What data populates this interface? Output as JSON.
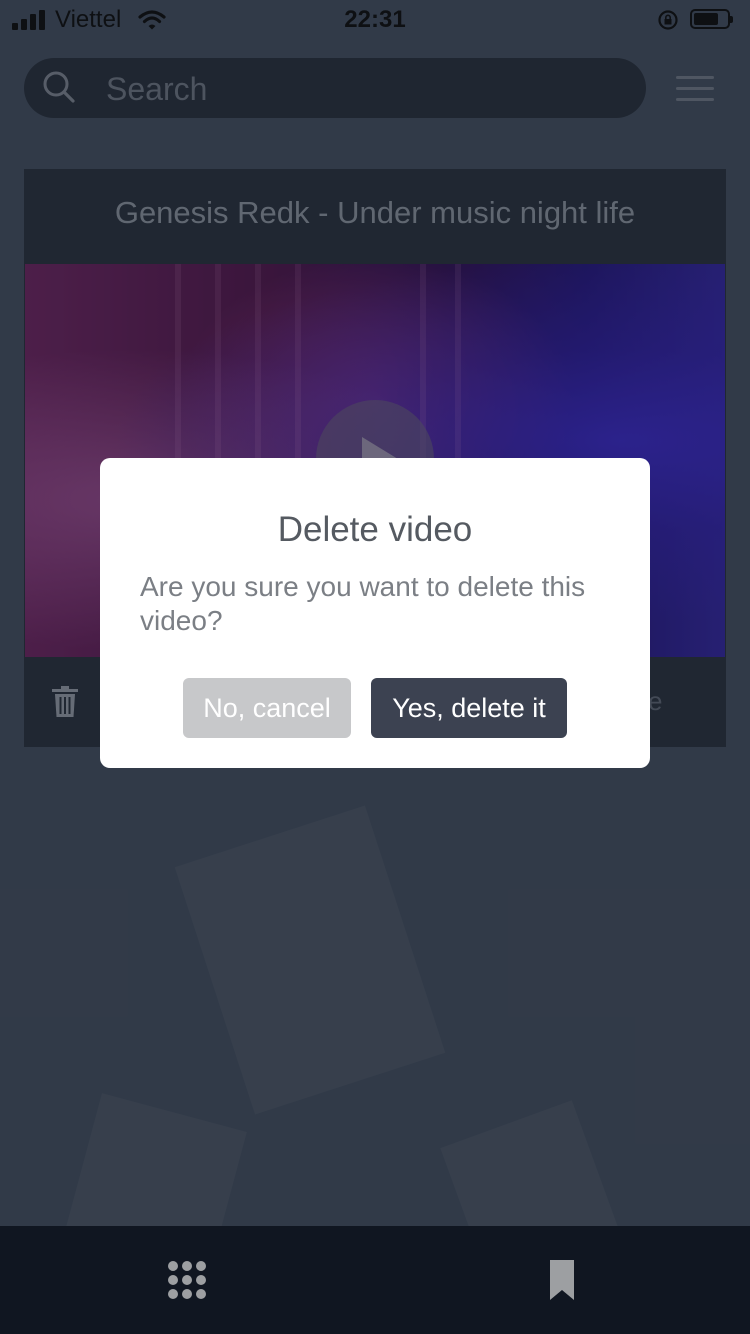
{
  "status_bar": {
    "carrier": "Viettel",
    "time": "22:31",
    "battery_level": 0.75
  },
  "search": {
    "placeholder": "Search"
  },
  "video_card": {
    "title": "Genesis Redk - Under music night life",
    "footer_label": "e"
  },
  "dialog": {
    "title": "Delete video",
    "message": "Are you sure you want to delete this video?",
    "cancel_label": "No, cancel",
    "confirm_label": "Yes, delete it"
  },
  "tab_bar": {
    "items": [
      {
        "icon": "grid-icon",
        "active": false
      },
      {
        "icon": "bookmark-icon",
        "active": true
      }
    ]
  },
  "colors": {
    "background": "#4c586a",
    "card": "#2f3745",
    "tab_bar": "#141b29",
    "confirm_button": "#3c4251",
    "cancel_button": "#c7c8ca"
  }
}
